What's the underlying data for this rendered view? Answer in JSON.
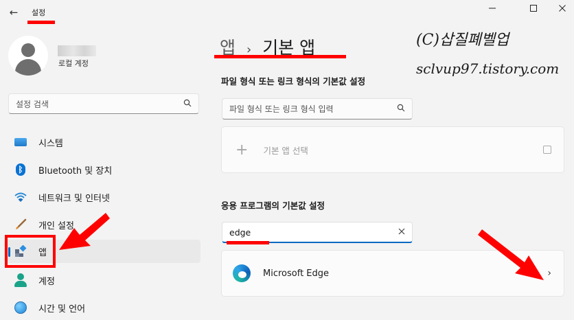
{
  "window": {
    "title": "설정",
    "back_icon": "arrow-left-icon",
    "controls": [
      "minimize-icon",
      "maximize-icon",
      "close-icon"
    ]
  },
  "account": {
    "type_label": "로컬 계정"
  },
  "search": {
    "placeholder": "설정 검색"
  },
  "sidebar": {
    "items": [
      {
        "label": "시스템",
        "icon": "system-icon"
      },
      {
        "label": "Bluetooth 및 장치",
        "icon": "bluetooth-icon"
      },
      {
        "label": "네트워크 및 인터넷",
        "icon": "wifi-icon"
      },
      {
        "label": "개인 설정",
        "icon": "paint-brush-icon"
      },
      {
        "label": "앱",
        "icon": "apps-icon",
        "selected": true
      },
      {
        "label": "계정",
        "icon": "account-icon"
      },
      {
        "label": "시간 및 언어",
        "icon": "globe-clock-icon"
      }
    ]
  },
  "breadcrumb": {
    "parent": "앱",
    "separator": "›",
    "current": "기본 앱"
  },
  "file_type_section": {
    "title": "파일 형식 또는 링크 형식의 기본값 설정",
    "input_placeholder": "파일 형식 또는 링크 형식 입력",
    "choose_default_label": "기본 앱 선택"
  },
  "app_section": {
    "title": "응용 프로그램의 기본값 설정",
    "search_value": "edge",
    "results": [
      {
        "name": "Microsoft Edge",
        "icon": "edge-icon"
      }
    ]
  },
  "watermark": {
    "line1": "(C)삽질폐벨업",
    "line2": "sclvup97.tistory.com"
  },
  "colors": {
    "accent": "#0067c0",
    "highlight_red": "#ff0000",
    "window_bg": "#f3f3f3",
    "card_bg": "#fbfbfb"
  }
}
